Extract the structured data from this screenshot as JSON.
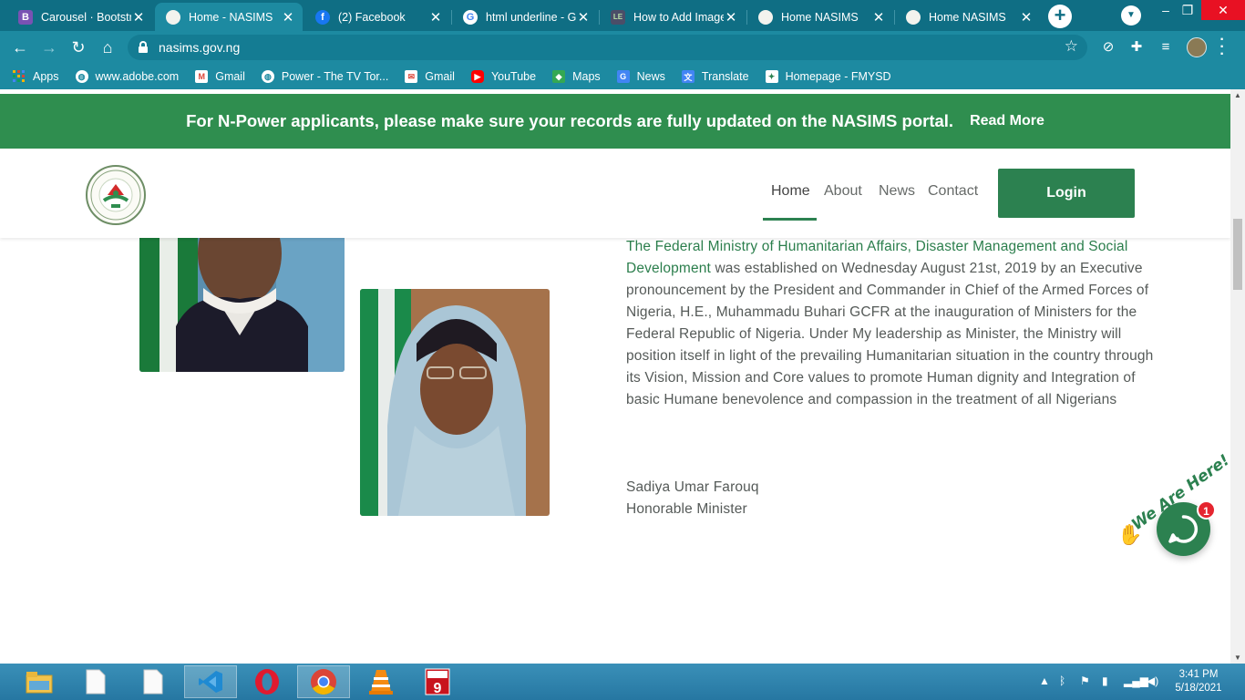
{
  "browser": {
    "tabs": [
      {
        "title": "Carousel · Bootstra",
        "icon": "bootstrap-icon",
        "active": false
      },
      {
        "title": "Home - NASIMS",
        "icon": "nasims-favicon",
        "active": true
      },
      {
        "title": "(2) Facebook",
        "icon": "facebook-icon",
        "active": false
      },
      {
        "title": "html underline - G",
        "icon": "google-icon",
        "active": false
      },
      {
        "title": "How to Add Image",
        "icon": "w3schools-icon",
        "active": false
      },
      {
        "title": "Home NASIMS",
        "icon": "nasims-favicon",
        "active": false
      },
      {
        "title": "Home NASIMS",
        "icon": "nasims-favicon",
        "active": false
      }
    ],
    "address": "nasims.gov.ng",
    "bookmarks": [
      {
        "label": "Apps",
        "icon": "apps-grid-icon"
      },
      {
        "label": "www.adobe.com",
        "icon": "globe-icon"
      },
      {
        "label": "Gmail",
        "icon": "gmail-icon"
      },
      {
        "label": "Power - The TV Tor...",
        "icon": "globe-icon"
      },
      {
        "label": "Gmail",
        "icon": "mail-icon"
      },
      {
        "label": "YouTube",
        "icon": "youtube-icon"
      },
      {
        "label": "Maps",
        "icon": "maps-icon"
      },
      {
        "label": "News",
        "icon": "news-icon"
      },
      {
        "label": "Translate",
        "icon": "translate-icon"
      },
      {
        "label": "Homepage - FMYSD",
        "icon": "fmysd-icon"
      }
    ]
  },
  "banner": {
    "message": "For N-Power applicants, please make sure your records are fully updated on the NASIMS portal.",
    "link": "Read More"
  },
  "nav": {
    "items": [
      "Home",
      "About",
      "News",
      "Contact"
    ],
    "active": "Home",
    "login": "Login"
  },
  "content": {
    "highlight": "The Federal Ministry of Humanitarian Affairs, Disaster Management and Social Development",
    "body": " was established on Wednesday August 21st, 2019 by an Executive pronouncement by the President and Commander in Chief of the Armed Forces of Nigeria, H.E., Muhammadu Buhari GCFR at the inauguration of Ministers for the Federal Republic of Nigeria. Under My leadership as Minister, the Ministry will position itself in light of the prevailing Humanitarian situation in the country through its Vision, Mission and Core values to promote Human dignity and Integration of basic Humane benevolence and compassion in the treatment of all Nigerians",
    "signature_name": "Sadiya Umar Farouq",
    "signature_title": "Honorable Minister"
  },
  "chat_widget": {
    "tagline": "We Are Here!",
    "badge": "1"
  },
  "taskbar": {
    "time": "3:41 PM",
    "date": "5/18/2021"
  },
  "colors": {
    "brand_green": "#2c8150",
    "banner_green": "#2f8e4f",
    "chrome_teal": "#1d8aa1"
  }
}
